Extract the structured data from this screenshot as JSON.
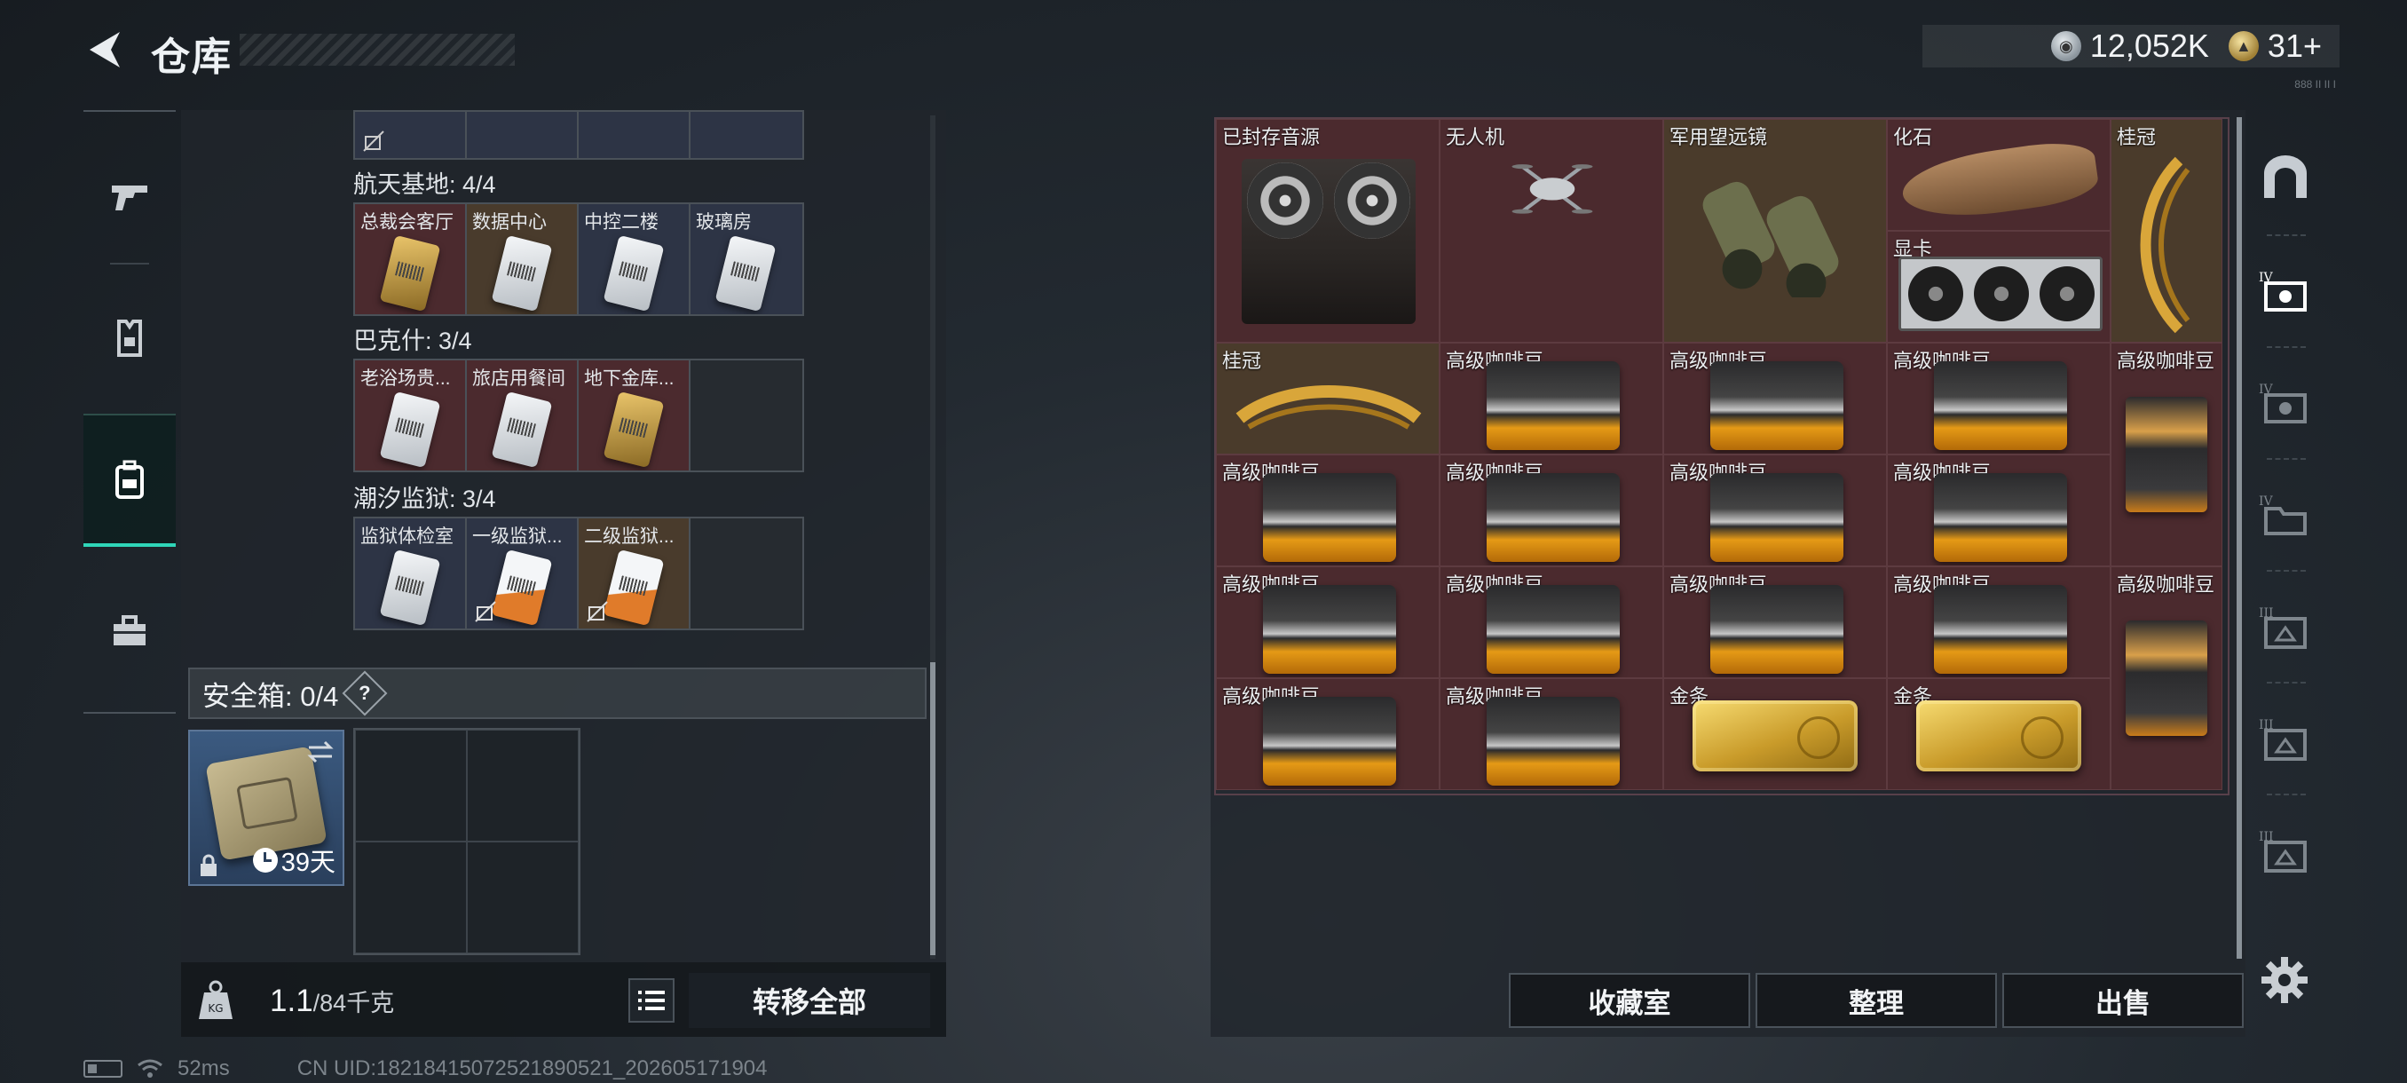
{
  "header": {
    "title": "仓库",
    "silver_amount": "12,052K",
    "gold_amount": "31+",
    "version_tag": "888 II II I"
  },
  "left_rail": {
    "items": [
      {
        "icon": "gun-icon"
      },
      {
        "icon": "armor-vest-icon"
      },
      {
        "icon": "backpack-icon",
        "active": true
      },
      {
        "icon": "toolbox-icon"
      }
    ]
  },
  "keycards": {
    "top_row_partial": [
      {
        "label": "",
        "style": "blue"
      },
      {
        "label": "",
        "style": "blue"
      },
      {
        "label": "",
        "style": "blue"
      },
      {
        "label": "",
        "style": "blue"
      }
    ],
    "groups": [
      {
        "title": "航天基地: 4/4",
        "cards": [
          {
            "label": "总裁会客厅",
            "style": "red",
            "card": "gold"
          },
          {
            "label": "数据中心",
            "style": "gold",
            "card": "white"
          },
          {
            "label": "中控二楼",
            "style": "blue",
            "card": "white"
          },
          {
            "label": "玻璃房",
            "style": "blue",
            "card": "white"
          }
        ]
      },
      {
        "title": "巴克什: 3/4",
        "cards": [
          {
            "label": "老浴场贵...",
            "style": "red",
            "card": "white"
          },
          {
            "label": "旅店用餐间",
            "style": "red",
            "card": "white"
          },
          {
            "label": "地下金库...",
            "style": "red",
            "card": "gold"
          },
          {
            "label": "",
            "style": "empty"
          }
        ]
      },
      {
        "title": "潮汐监狱: 3/4",
        "cards": [
          {
            "label": "监狱体检室",
            "style": "blue",
            "card": "white"
          },
          {
            "label": "一级监狱...",
            "style": "blue",
            "card": "orange",
            "nosignal": true
          },
          {
            "label": "二级监狱...",
            "style": "gold",
            "card": "orange",
            "nosignal": true
          },
          {
            "label": "",
            "style": "empty"
          }
        ]
      }
    ]
  },
  "safe_box": {
    "header": "安全箱: 0/4",
    "help_label": "?",
    "timer": "39天"
  },
  "left_footer": {
    "weight_current": "1.1",
    "weight_max": "/84千克",
    "transfer_all": "转移全部"
  },
  "items": {
    "row1": [
      "已封存音源",
      "无人机",
      "军用望远镜",
      "化石",
      "桂冠",
      "显卡"
    ],
    "laurel_h": "桂冠",
    "coffee": "高级咖啡豆",
    "gold_bar": "金条"
  },
  "right_actions": {
    "collection": "收藏室",
    "organize": "整理",
    "sell": "出售"
  },
  "right_rail": {
    "items": [
      {
        "icon": "arch-gate-icon"
      },
      {
        "icon": "level-4-container-icon",
        "active": true
      },
      {
        "icon": "level-4-container-icon"
      },
      {
        "icon": "level-4-folder-icon"
      },
      {
        "icon": "level-3-crate-icon"
      },
      {
        "icon": "level-3-crate-icon"
      },
      {
        "icon": "level-3-crate-icon"
      }
    ],
    "settings_icon": "gear-icon"
  },
  "status_bar": {
    "ping": "52ms",
    "uid": "CN UID:18218415072521890521_202605171904"
  },
  "colors": {
    "accent": "#2fd6b8",
    "item_red": "#4b2a2e",
    "item_gold": "#4a3b2b",
    "item_blue": "#2d3445"
  }
}
